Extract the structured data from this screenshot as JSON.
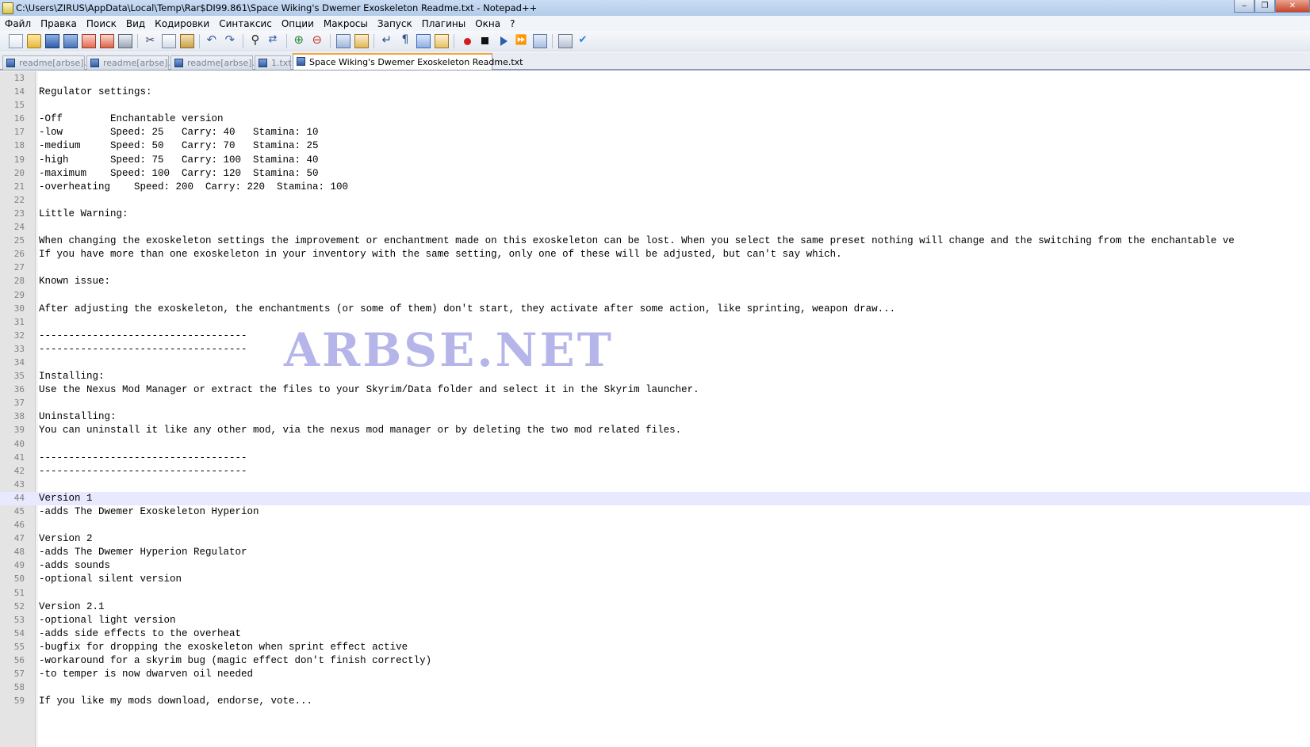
{
  "window": {
    "title": "C:\\Users\\ZIRUS\\AppData\\Local\\Temp\\Rar$DI99.861\\Space Wiking's Dwemer Exoskeleton Readme.txt - Notepad++",
    "minimize_glyph": "‒",
    "maximize_glyph": "❐",
    "close_glyph": "✕"
  },
  "menu": [
    {
      "label": "Файл"
    },
    {
      "label": "Правка"
    },
    {
      "label": "Поиск"
    },
    {
      "label": "Вид"
    },
    {
      "label": "Кодировки"
    },
    {
      "label": "Синтаксис"
    },
    {
      "label": "Опции"
    },
    {
      "label": "Макросы"
    },
    {
      "label": "Запуск"
    },
    {
      "label": "Плагины"
    },
    {
      "label": "Окна"
    },
    {
      "label": "?"
    }
  ],
  "toolbar": {
    "icons": [
      "file-new-icon",
      "folder-open-icon",
      "save-icon",
      "save-all-icon",
      "close-doc-icon",
      "close-all-icon",
      "print-icon",
      "cut-icon",
      "copy-icon",
      "paste-icon",
      "undo-icon",
      "redo-icon",
      "find-icon",
      "replace-icon",
      "zoom-in-icon",
      "zoom-out-icon",
      "sync-vertical-icon",
      "sync-horizontal-icon",
      "word-wrap-icon",
      "show-all-chars-icon",
      "indent-guide-icon",
      "document-map-icon",
      "record-macro-icon",
      "stop-macro-icon",
      "play-macro-icon",
      "run-macro-multiple-icon",
      "save-macro-icon",
      "plugin-icon",
      "spell-check-icon"
    ]
  },
  "tabs": [
    {
      "label": "readme[arbse].txt",
      "active": false
    },
    {
      "label": "readme[arbse].txt",
      "active": false
    },
    {
      "label": "readme[arbse].txt",
      "active": false
    },
    {
      "label": "1.txt",
      "active": false
    },
    {
      "label": "Space Wiking's Dwemer Exoskeleton Readme.txt",
      "active": true
    }
  ],
  "editor": {
    "current_line": 44,
    "watermark": "ARBSE.NET",
    "lines": [
      {
        "n": "13",
        "text": ""
      },
      {
        "n": "14",
        "text": "Regulator settings:"
      },
      {
        "n": "15",
        "text": ""
      },
      {
        "n": "16",
        "text": "-Off        Enchantable version"
      },
      {
        "n": "17",
        "text": "-low        Speed: 25   Carry: 40   Stamina: 10"
      },
      {
        "n": "18",
        "text": "-medium     Speed: 50   Carry: 70   Stamina: 25"
      },
      {
        "n": "19",
        "text": "-high       Speed: 75   Carry: 100  Stamina: 40"
      },
      {
        "n": "20",
        "text": "-maximum    Speed: 100  Carry: 120  Stamina: 50"
      },
      {
        "n": "21",
        "text": "-overheating    Speed: 200  Carry: 220  Stamina: 100"
      },
      {
        "n": "22",
        "text": ""
      },
      {
        "n": "23",
        "text": "Little Warning:"
      },
      {
        "n": "24",
        "text": ""
      },
      {
        "n": "25",
        "text": "When changing the exoskeleton settings the improvement or enchantment made on this exoskeleton can be lost. When you select the same preset nothing will change and the switching from the enchantable ve"
      },
      {
        "n": "26",
        "text": "If you have more than one exoskeleton in your inventory with the same setting, only one of these will be adjusted, but can't say which."
      },
      {
        "n": "27",
        "text": ""
      },
      {
        "n": "28",
        "text": "Known issue:"
      },
      {
        "n": "29",
        "text": ""
      },
      {
        "n": "30",
        "text": "After adjusting the exoskeleton, the enchantments (or some of them) don't start, they activate after some action, like sprinting, weapon draw..."
      },
      {
        "n": "31",
        "text": ""
      },
      {
        "n": "32",
        "text": "-----------------------------------"
      },
      {
        "n": "33",
        "text": "-----------------------------------"
      },
      {
        "n": "34",
        "text": ""
      },
      {
        "n": "35",
        "text": "Installing:"
      },
      {
        "n": "36",
        "text": "Use the Nexus Mod Manager or extract the files to your Skyrim/Data folder and select it in the Skyrim launcher."
      },
      {
        "n": "37",
        "text": ""
      },
      {
        "n": "38",
        "text": "Uninstalling:"
      },
      {
        "n": "39",
        "text": "You can uninstall it like any other mod, via the nexus mod manager or by deleting the two mod related files."
      },
      {
        "n": "40",
        "text": ""
      },
      {
        "n": "41",
        "text": "-----------------------------------"
      },
      {
        "n": "42",
        "text": "-----------------------------------"
      },
      {
        "n": "43",
        "text": ""
      },
      {
        "n": "44",
        "text": "Version 1"
      },
      {
        "n": "45",
        "text": "-adds The Dwemer Exoskeleton Hyperion"
      },
      {
        "n": "46",
        "text": ""
      },
      {
        "n": "47",
        "text": "Version 2"
      },
      {
        "n": "48",
        "text": "-adds The Dwemer Hyperion Regulator"
      },
      {
        "n": "49",
        "text": "-adds sounds"
      },
      {
        "n": "50",
        "text": "-optional silent version"
      },
      {
        "n": "51",
        "text": ""
      },
      {
        "n": "52",
        "text": "Version 2.1"
      },
      {
        "n": "53",
        "text": "-optional light version"
      },
      {
        "n": "54",
        "text": "-adds side effects to the overheat"
      },
      {
        "n": "55",
        "text": "-bugfix for dropping the exoskeleton when sprint effect active"
      },
      {
        "n": "56",
        "text": "-workaround for a skyrim bug (magic effect don't finish correctly)"
      },
      {
        "n": "57",
        "text": "-to temper is now dwarven oil needed"
      },
      {
        "n": "58",
        "text": ""
      },
      {
        "n": "59",
        "text": "If you like my mods download, endorse, vote..."
      }
    ]
  }
}
